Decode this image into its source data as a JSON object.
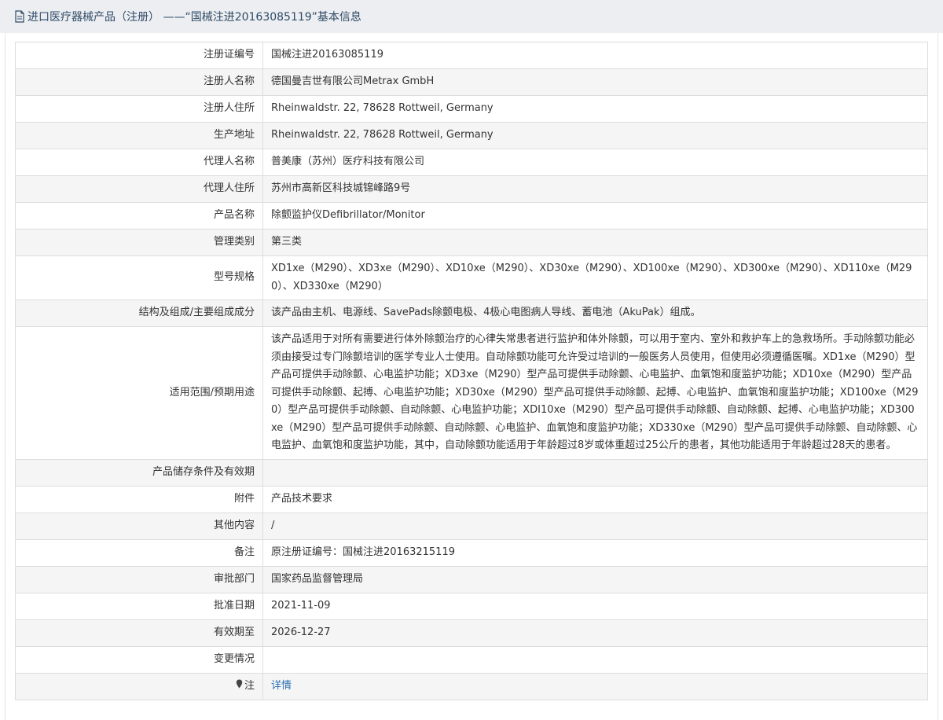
{
  "header": {
    "title": "进口医疗器械产品（注册） ——“国械注进20163085119”基本信息",
    "icon": "document-icon"
  },
  "rows": [
    {
      "label": "注册证编号",
      "value": "国械注进20163085119"
    },
    {
      "label": "注册人名称",
      "value": "德国曼吉世有限公司Metrax GmbH"
    },
    {
      "label": "注册人住所",
      "value": "Rheinwaldstr. 22, 78628 Rottweil, Germany"
    },
    {
      "label": "生产地址",
      "value": "Rheinwaldstr. 22, 78628 Rottweil, Germany"
    },
    {
      "label": "代理人名称",
      "value": "普美康（苏州）医疗科技有限公司"
    },
    {
      "label": "代理人住所",
      "value": "苏州市高新区科技城锦峰路9号"
    },
    {
      "label": "产品名称",
      "value": "除颤监护仪Defibrillator/Monitor"
    },
    {
      "label": "管理类别",
      "value": "第三类"
    },
    {
      "label": "型号规格",
      "value": "XD1xe（M290）、XD3xe（M290）、XD10xe（M290）、XD30xe（M290）、XD100xe（M290）、XD300xe（M290）、XD110xe（M290）、XD330xe（M290）"
    },
    {
      "label": "结构及组成/主要组成成分",
      "value": "该产品由主机、电源线、SavePads除颤电极、4极心电图病人导线、蓄电池（AkuPak）组成。"
    },
    {
      "label": "适用范围/预期用途",
      "value": "该产品适用于对所有需要进行体外除颤治疗的心律失常患者进行监护和体外除颤，可以用于室内、室外和救护车上的急救场所。手动除颤功能必须由接受过专门除颤培训的医学专业人士使用。自动除颤功能可允许受过培训的一般医务人员使用，但使用必须遵循医嘱。XD1xe（M290）型产品可提供手动除颤、心电监护功能；XD3xe（M290）型产品可提供手动除颤、心电监护、血氧饱和度监护功能；XD10xe（M290）型产品可提供手动除颤、起搏、心电监护功能；XD30xe（M290）型产品可提供手动除颤、起搏、心电监护、血氧饱和度监护功能；XD100xe（M290）型产品可提供手动除颤、自动除颤、心电监护功能；XDI10xe（M290）型产品可提供手动除颤、自动除颤、起搏、心电监护功能；XD300xe（M290）型产品可提供手动除颤、自动除颤、心电监护、血氧饱和度监护功能；XD330xe（M290）型产品可提供手动除颤、自动除颤、心电监护、血氧饱和度监护功能，其中，自动除颤功能适用于年龄超过8岁或体重超过25公斤的患者，其他功能适用于年龄超过28天的患者。"
    },
    {
      "label": "产品储存条件及有效期",
      "value": ""
    },
    {
      "label": "附件",
      "value": "产品技术要求"
    },
    {
      "label": "其他内容",
      "value": "/"
    },
    {
      "label": "备注",
      "value": "原注册证编号：国械注进20163215119"
    },
    {
      "label": "审批部门",
      "value": "国家药品监督管理局"
    },
    {
      "label": "批准日期",
      "value": "2021-11-09"
    },
    {
      "label": "有效期至",
      "value": "2026-12-27"
    },
    {
      "label": "变更情况",
      "value": ""
    }
  ],
  "note_row": {
    "label": "注",
    "icon": "map-pin-icon",
    "link": "详情"
  },
  "colors": {
    "header_bg": "#eceef1",
    "header_text": "#2e4a66",
    "link": "#2a6fb5",
    "row_alt": "#f5f5f5",
    "border": "#dddddd"
  }
}
